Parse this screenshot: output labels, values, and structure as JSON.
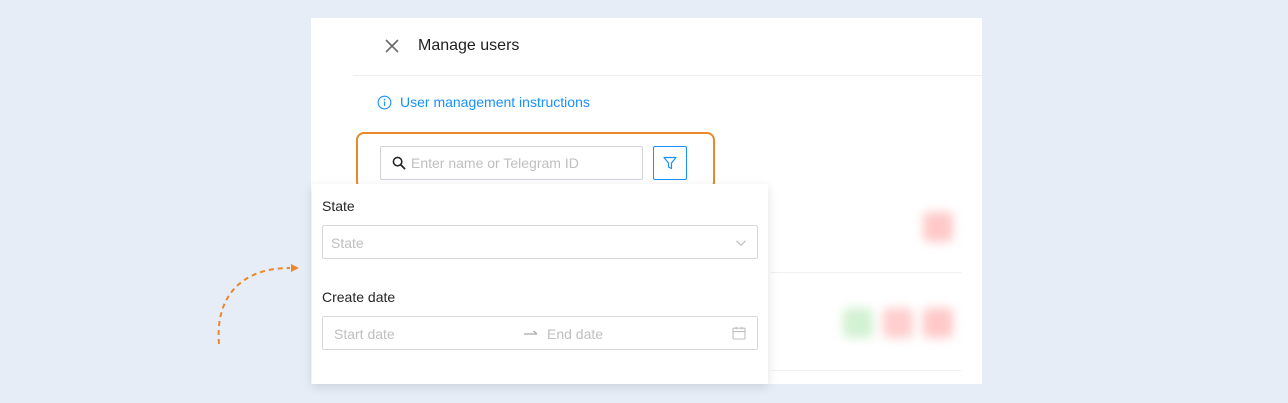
{
  "header": {
    "title": "Manage users",
    "close_icon": "close-icon"
  },
  "info_link": {
    "label": "User management instructions",
    "icon": "info-icon"
  },
  "search": {
    "placeholder": "Enter name or Telegram ID",
    "value": "",
    "icon": "search-icon"
  },
  "filter_button": {
    "icon": "filter-icon"
  },
  "filter_panel": {
    "state": {
      "label": "State",
      "placeholder": "State",
      "icon": "chevron-down-icon"
    },
    "create_date": {
      "label": "Create date",
      "start_placeholder": "Start date",
      "end_placeholder": "End date",
      "separator_icon": "arrow-right-icon",
      "icon": "calendar-icon"
    }
  },
  "colors": {
    "background": "#e6edf7",
    "accent": "#1890ff",
    "highlight": "#e8882a",
    "placeholder": "#bfbfbf"
  }
}
